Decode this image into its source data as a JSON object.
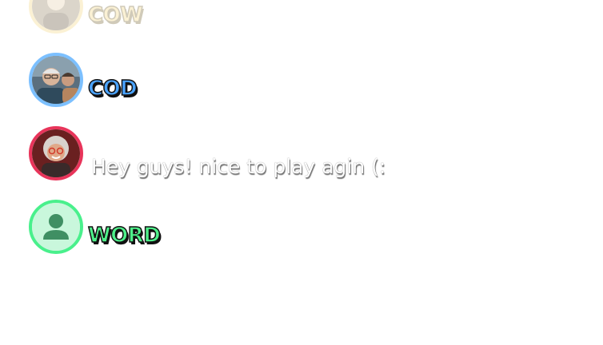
{
  "colors": {
    "gold_ring": "#f4d985",
    "blue_ring": "#7cc0ff",
    "red_ring": "#e8345a",
    "green_ring": "#49f08c",
    "word_blue": "#4aa3ff",
    "word_green": "#4ef08a",
    "word_gold": "#f4d985"
  },
  "chat": {
    "entries": [
      {
        "avatar_icon": "player-photo-icon",
        "text": "COW"
      },
      {
        "avatar_icon": "player-photo-icon",
        "text": "COD"
      },
      {
        "avatar_icon": "player-photo-icon",
        "text": "Hey guys! nice to play agin (:"
      },
      {
        "avatar_icon": "default-user-icon",
        "text": "WORD"
      }
    ]
  }
}
